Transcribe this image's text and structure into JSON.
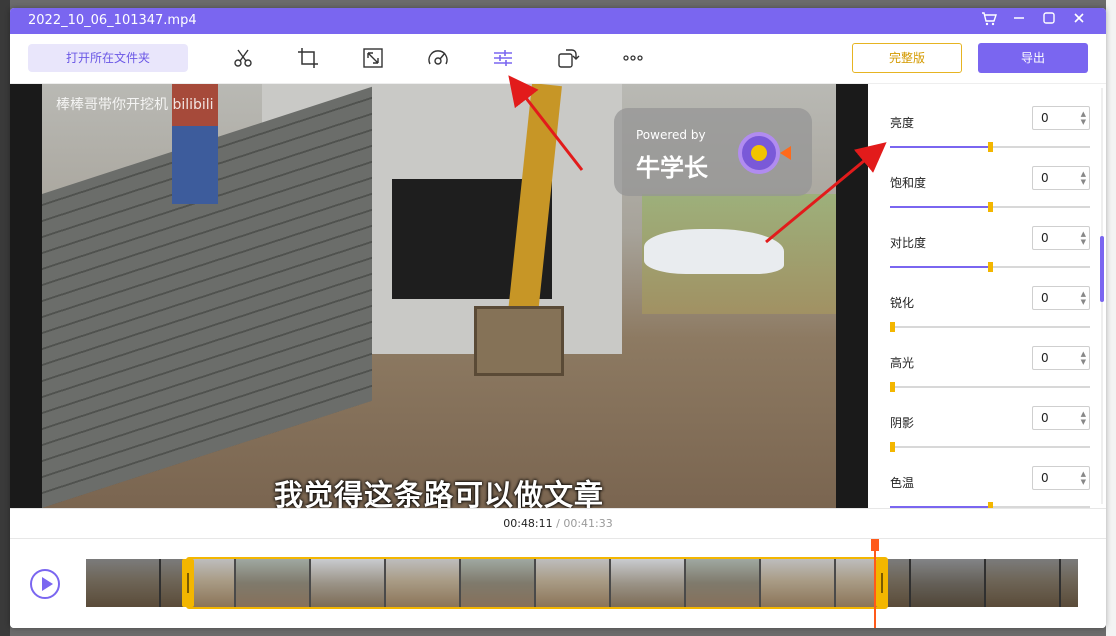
{
  "window": {
    "title": "2022_10_06_101347.mp4",
    "controls": [
      "cart-icon",
      "minimize-icon",
      "maximize-icon",
      "close-icon"
    ],
    "accent": "#7a66f0"
  },
  "toolbar": {
    "open_folder": "打开所在文件夹",
    "tools": [
      "scissors-icon",
      "crop-icon",
      "resize-icon",
      "speed-icon",
      "adjust-icon",
      "rotate-icon",
      "more-icon"
    ],
    "full_version": "完整版",
    "export": "导出"
  },
  "video": {
    "watermark": "棒棒哥带你开挖机",
    "watermark_brand": "bilibili",
    "subtitle": "我觉得这条路可以做文章",
    "powered_by": "Powered by",
    "brand": "牛学长"
  },
  "adjustments": [
    {
      "label": "亮度",
      "value": "0",
      "position": 0.5
    },
    {
      "label": "饱和度",
      "value": "0",
      "position": 0.5
    },
    {
      "label": "对比度",
      "value": "0",
      "position": 0.5
    },
    {
      "label": "锐化",
      "value": "0",
      "position": 0.0
    },
    {
      "label": "高光",
      "value": "0",
      "position": 0.0
    },
    {
      "label": "阴影",
      "value": "0",
      "position": 0.0
    },
    {
      "label": "色温",
      "value": "0",
      "position": 0.5
    }
  ],
  "playback": {
    "current": "00:48:11",
    "separator": " / ",
    "total": "00:41:33"
  }
}
